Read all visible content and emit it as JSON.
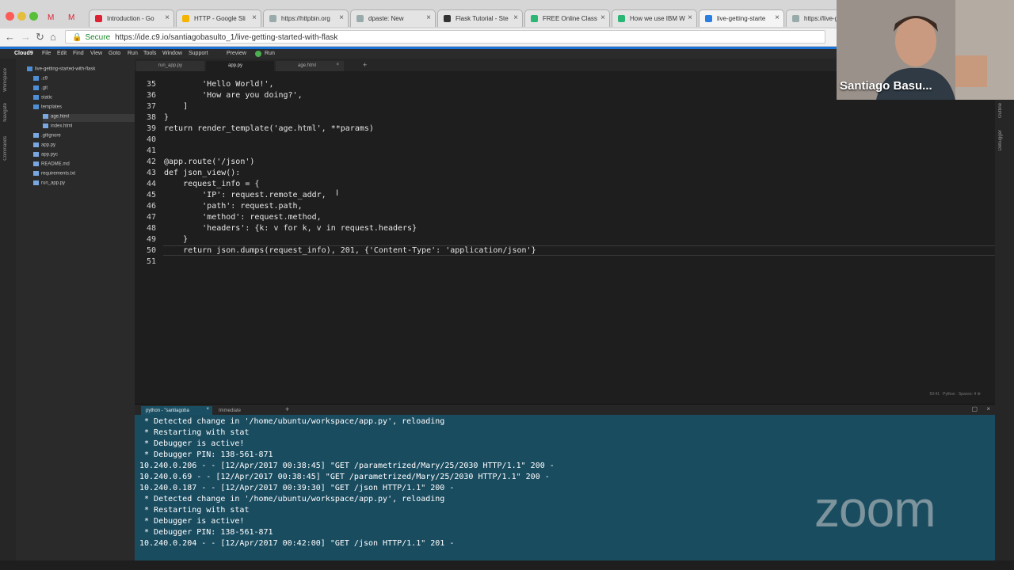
{
  "browser": {
    "tabs": [
      {
        "label": "Introduction - Go",
        "icon": "gmail-icon"
      },
      {
        "label": "HTTP - Google Sli",
        "icon": "slides-icon"
      },
      {
        "label": "https://httpbin.org",
        "icon": "page-icon"
      },
      {
        "label": "dpaste: New",
        "icon": "page-icon"
      },
      {
        "label": "Flask Tutorial - Ste",
        "icon": "r-icon"
      },
      {
        "label": "FREE Online Class",
        "icon": "m-icon"
      },
      {
        "label": "How we use IBM W",
        "icon": "m-icon"
      },
      {
        "label": "live-getting-starte",
        "icon": "c9-icon"
      },
      {
        "label": "https://live-g",
        "icon": "page-icon"
      }
    ],
    "secure_label": "Secure",
    "url": "https://ide.c9.io/santiagobasulto_1/live-getting-started-with-flask"
  },
  "ide": {
    "menu": [
      "Cloud9",
      "File",
      "Edit",
      "Find",
      "View",
      "Goto",
      "Run",
      "Tools",
      "Window",
      "Support",
      "Preview",
      "Run"
    ],
    "left_rail": [
      "Workspace",
      "Navigate",
      "Commands"
    ],
    "right_rail": [
      "Outline",
      "Debugger"
    ],
    "tree": [
      {
        "label": "live-getting-started-with-flask",
        "depth": 0,
        "kind": "folder"
      },
      {
        "label": ".c9",
        "depth": 1,
        "kind": "folder"
      },
      {
        "label": ".git",
        "depth": 1,
        "kind": "folder"
      },
      {
        "label": "static",
        "depth": 1,
        "kind": "folder"
      },
      {
        "label": "templates",
        "depth": 1,
        "kind": "folder"
      },
      {
        "label": "age.html",
        "depth": 2,
        "kind": "file",
        "selected": true
      },
      {
        "label": "index.html",
        "depth": 2,
        "kind": "file"
      },
      {
        "label": ".gitignore",
        "depth": 1,
        "kind": "file"
      },
      {
        "label": "app.py",
        "depth": 1,
        "kind": "file"
      },
      {
        "label": "app.pyc",
        "depth": 1,
        "kind": "file"
      },
      {
        "label": "README.md",
        "depth": 1,
        "kind": "file"
      },
      {
        "label": "requirements.txt",
        "depth": 1,
        "kind": "file"
      },
      {
        "label": "run_app.py",
        "depth": 1,
        "kind": "file"
      }
    ],
    "editor_tabs": [
      "run_app.py",
      "app.py",
      "age.html"
    ],
    "code_lines": [
      {
        "n": "35",
        "text": "        'Hello World!',"
      },
      {
        "n": "36",
        "text": "        'How are you doing?',"
      },
      {
        "n": "37",
        "text": "    ]"
      },
      {
        "n": "38",
        "text": "}"
      },
      {
        "n": "39",
        "text": "return render_template('age.html', **params)"
      },
      {
        "n": "40",
        "text": ""
      },
      {
        "n": "41",
        "text": ""
      },
      {
        "n": "42",
        "text": "@app.route('/json')"
      },
      {
        "n": "43",
        "text": "def json_view():"
      },
      {
        "n": "44",
        "text": "    request_info = {"
      },
      {
        "n": "45",
        "text": "        'IP': request.remote_addr,"
      },
      {
        "n": "46",
        "text": "        'path': request.path,"
      },
      {
        "n": "47",
        "text": "        'method': request.method,"
      },
      {
        "n": "48",
        "text": "        'headers': {k: v for k, v in request.headers}"
      },
      {
        "n": "49",
        "text": "    }"
      },
      {
        "n": "50",
        "text": "    return json.dumps(request_info), 201, {'Content-Type': 'application/json'}"
      },
      {
        "n": "51",
        "text": ""
      }
    ],
    "status": {
      "position": "50:41",
      "language": "Python",
      "spaces": "Spaces: 4"
    },
    "terminal_tabs": [
      "python - \"santiagoba",
      "Immediate"
    ],
    "terminal_lines": [
      " * Detected change in '/home/ubuntu/workspace/app.py', reloading",
      " * Restarting with stat",
      " * Debugger is active!",
      " * Debugger PIN: 138-561-871",
      "10.240.0.206 - - [12/Apr/2017 00:38:45] \"GET /parametrized/Mary/25/2030 HTTP/1.1\" 200 -",
      "10.240.0.69 - - [12/Apr/2017 00:38:45] \"GET /parametrized/Mary/25/2030 HTTP/1.1\" 200 -",
      "10.240.0.187 - - [12/Apr/2017 00:39:30] \"GET /json HTTP/1.1\" 200 -",
      " * Detected change in '/home/ubuntu/workspace/app.py', reloading",
      " * Restarting with stat",
      " * Debugger is active!",
      " * Debugger PIN: 138-561-871",
      "10.240.0.204 - - [12/Apr/2017 00:42:00] \"GET /json HTTP/1.1\" 201 -"
    ]
  },
  "webcam": {
    "name": "Santiago Basu..."
  },
  "watermark": "zoom"
}
